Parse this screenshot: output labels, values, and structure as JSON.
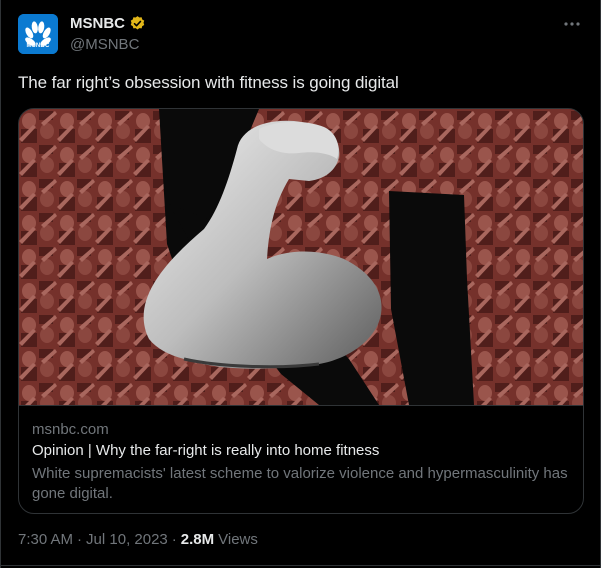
{
  "account": {
    "display_name": "MSNBC",
    "handle": "@MSNBC",
    "avatar_text": "MSNBC",
    "verified": true
  },
  "tweet": {
    "text": "The far right’s obsession with fitness is going digital"
  },
  "card": {
    "domain": "msnbc.com",
    "title": "Opinion | Why the far-right is really into home fitness",
    "description": "White supremacists' latest scheme to valorize violence and hypermasculinity has gone digital."
  },
  "meta": {
    "time": "7:30 AM",
    "date": "Jul 10, 2023",
    "separator": "·",
    "views_count": "2.8M",
    "views_label": "Views"
  },
  "icons": {
    "more": "more-horizontal-icon",
    "verified": "verified-badge-icon"
  },
  "colors": {
    "background": "#000000",
    "text_primary": "#e7e9ea",
    "text_secondary": "#71767b",
    "border": "#2f3336",
    "brand_blue": "#0b7ad1",
    "verified_gold": "#e2b719",
    "image_red": "#8a3a33"
  }
}
